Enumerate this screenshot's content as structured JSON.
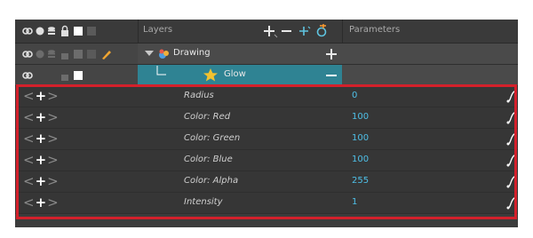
{
  "header": {
    "layers_label": "Layers",
    "parameters_label": "Parameters"
  },
  "layers": [
    {
      "name": "Drawing"
    },
    {
      "name": "Glow"
    }
  ],
  "parameters": [
    {
      "label": "Radius",
      "value": "0"
    },
    {
      "label": "Color: Red",
      "value": "100"
    },
    {
      "label": "Color: Green",
      "value": "100"
    },
    {
      "label": "Color: Blue",
      "value": "100"
    },
    {
      "label": "Color: Alpha",
      "value": "255"
    },
    {
      "label": "Intensity",
      "value": "1"
    }
  ],
  "colors": {
    "selected_layer": "#2f8393",
    "value_text": "#4ec0e8",
    "highlight_border": "#d4202b"
  },
  "icons": [
    "onion-skin-icon",
    "visibility-icon",
    "stack-icon",
    "lock-icon",
    "color-swatch-icon",
    "pencil-icon",
    "add-layer-icon",
    "remove-layer-icon",
    "add-effect-icon",
    "star-icon",
    "function-curve-icon"
  ]
}
